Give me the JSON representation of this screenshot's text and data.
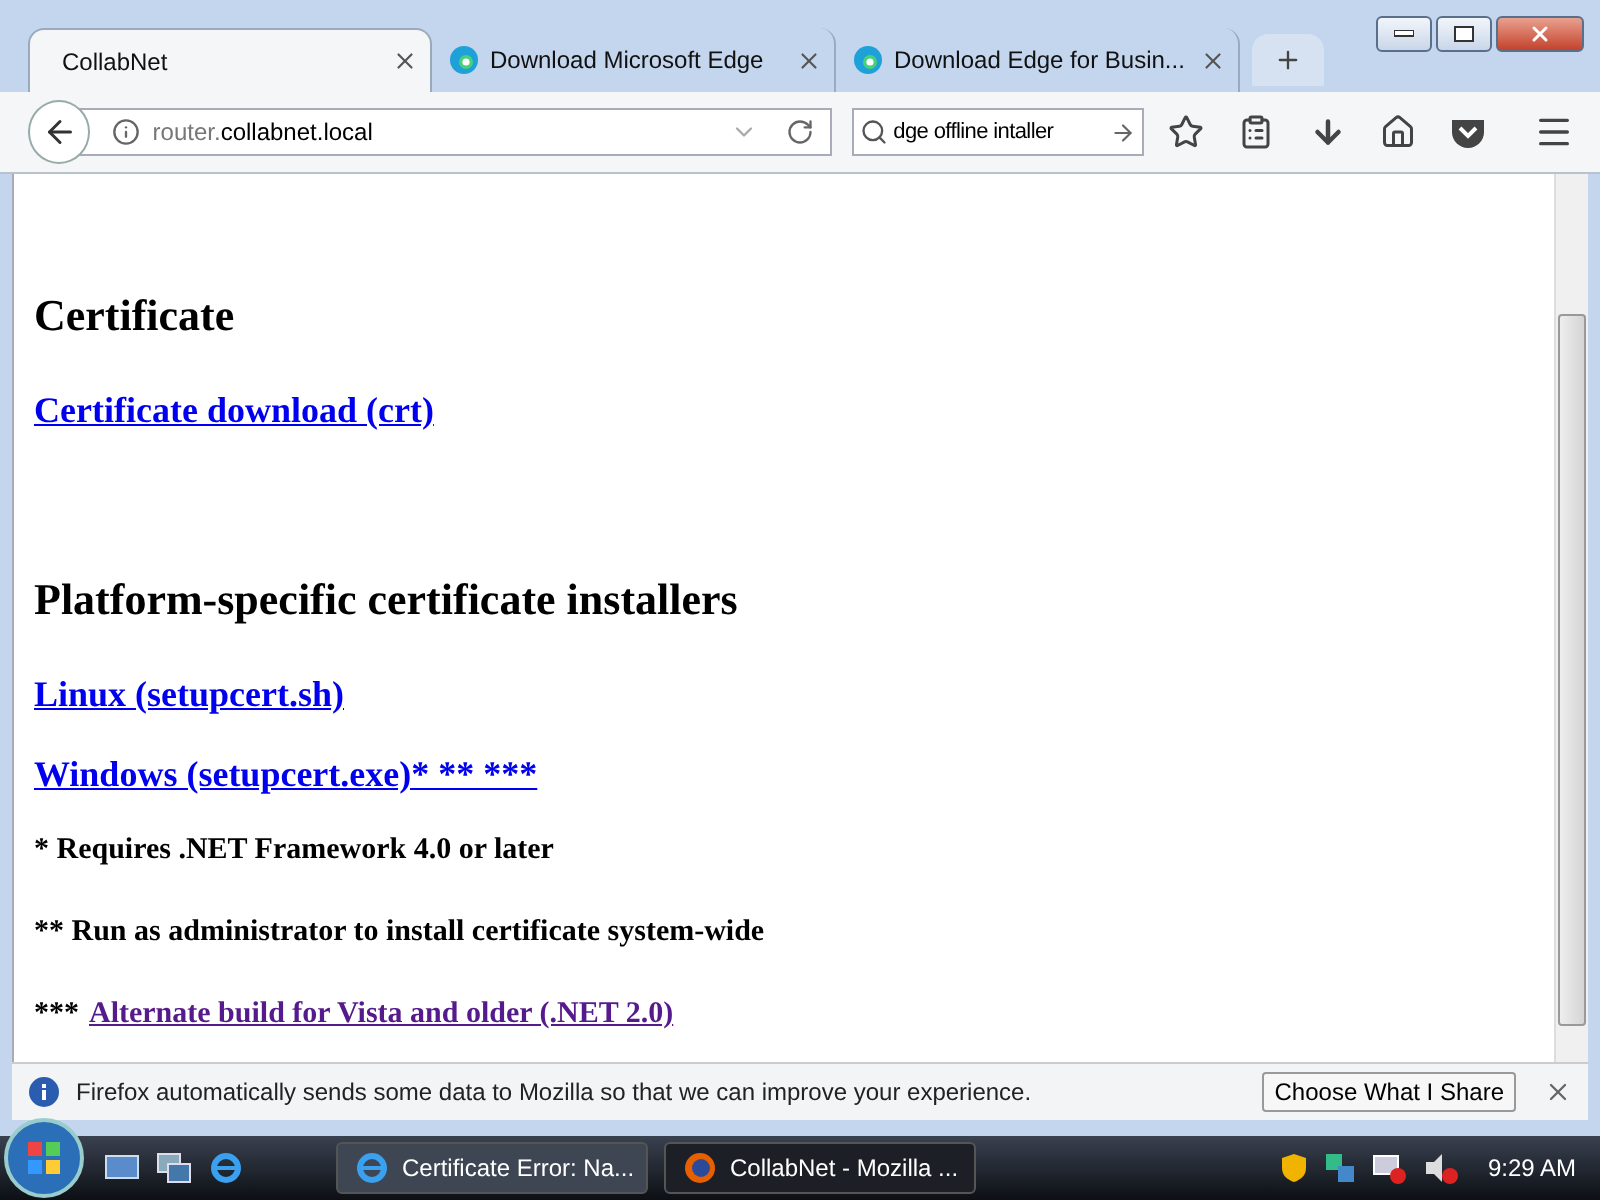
{
  "tabs": [
    {
      "title": "CollabNet",
      "selected": true,
      "kind": "plain"
    },
    {
      "title": "Download Microsoft Edge",
      "selected": false,
      "kind": "edge"
    },
    {
      "title": "Download Edge for Busin...",
      "selected": false,
      "kind": "edge"
    }
  ],
  "address": {
    "host_prefix": "router.",
    "host_domain": "collabnet.local"
  },
  "search": {
    "value": "dge offline intaller"
  },
  "sections": [
    {
      "heading": "Certificate",
      "items": [
        {
          "kind": "link",
          "text": "Certificate download (crt)",
          "visited": false
        }
      ]
    },
    {
      "heading": "Platform-specific certificate installers",
      "items": [
        {
          "kind": "link",
          "text": "Linux (setupcert.sh)",
          "visited": false
        },
        {
          "kind": "link",
          "text": "Windows (setupcert.exe)* ** ***",
          "visited": false
        },
        {
          "kind": "note",
          "text": "* Requires .NET Framework 4.0 or later"
        },
        {
          "kind": "note",
          "text": "** Run as administrator to install certificate system-wide"
        },
        {
          "kind": "note_link",
          "prefix": "***",
          "text": "Alternate build for Vista and older (.NET 2.0)",
          "visited": true
        }
      ]
    }
  ],
  "notification": {
    "message": "Firefox automatically sends some data to Mozilla so that we can improve your experience.",
    "button": "Choose What I Share"
  },
  "taskbar": {
    "tasks": [
      {
        "label": "Certificate Error: Na...",
        "selected": false,
        "kind": "ie"
      },
      {
        "label": "CollabNet - Mozilla ...",
        "selected": true,
        "kind": "firefox"
      }
    ],
    "clock": "9:29 AM"
  }
}
